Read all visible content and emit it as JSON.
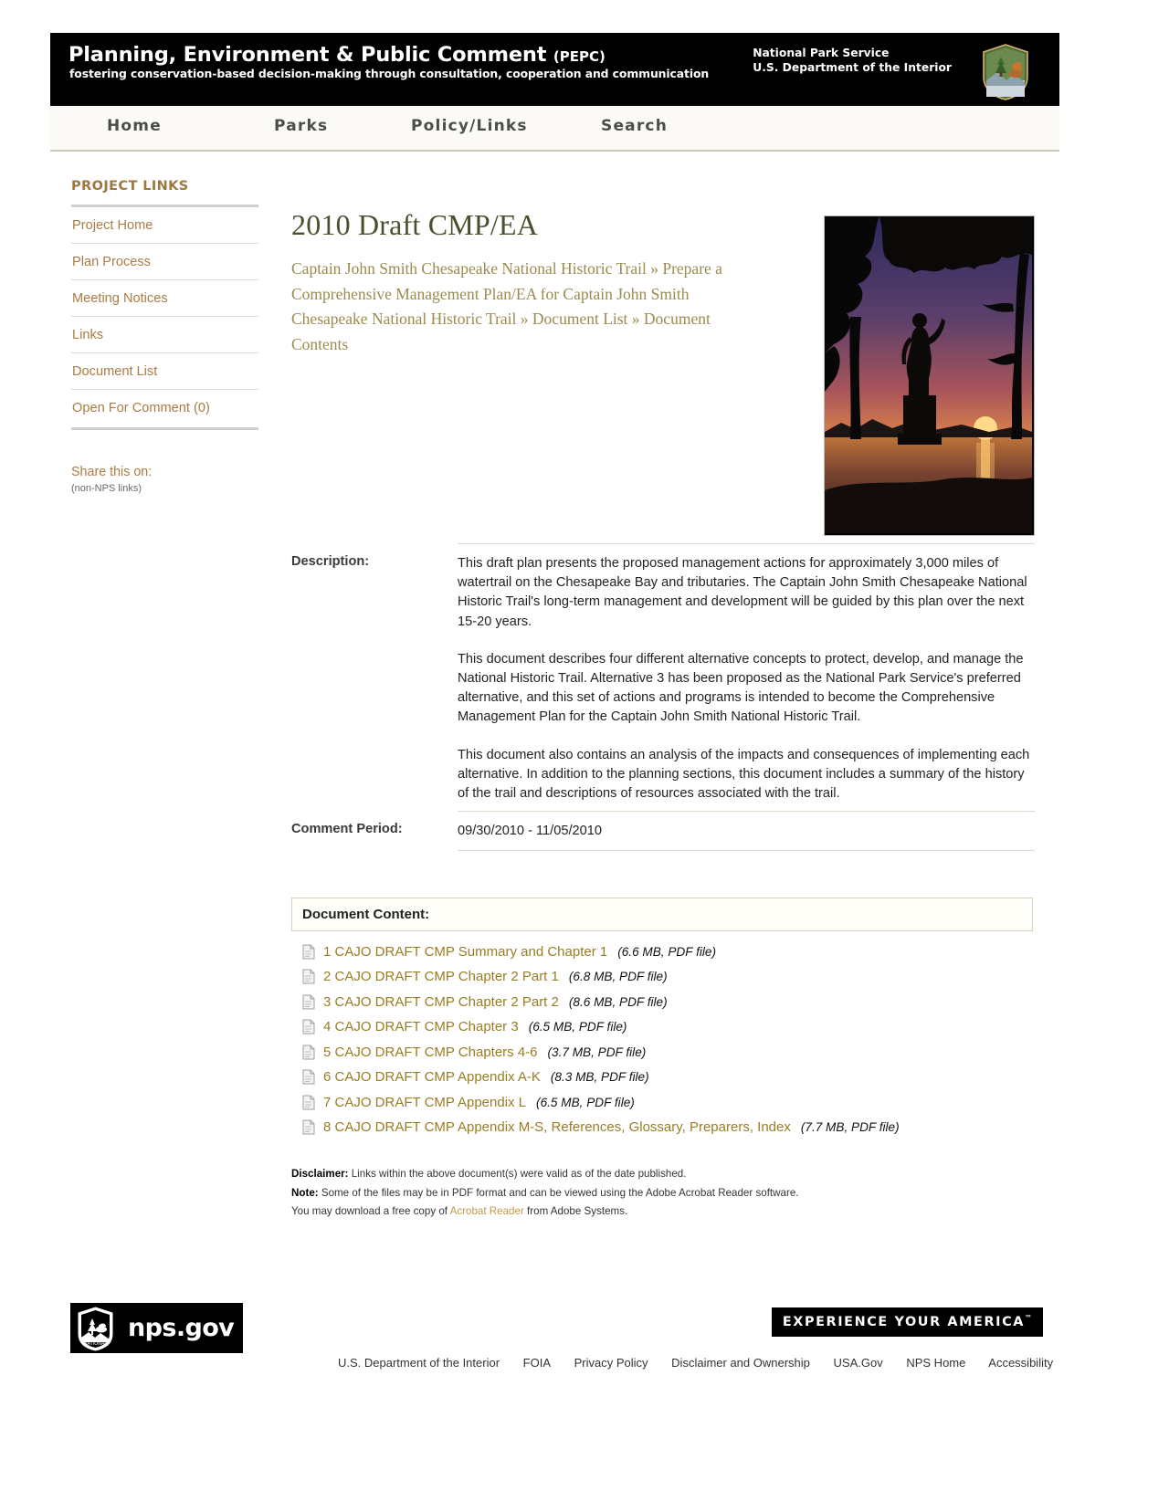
{
  "banner": {
    "title": "Planning, Environment & Public Comment",
    "acronym": "(PEPC)",
    "tagline": "fostering conservation-based decision-making through consultation, cooperation and communication",
    "agency_line1": "National Park Service",
    "agency_line2": "U.S. Department of the Interior",
    "logo_icon": "nps-arrowhead-icon"
  },
  "nav": {
    "items": [
      {
        "label": "Home"
      },
      {
        "label": "Parks"
      },
      {
        "label": "Policy/Links"
      },
      {
        "label": "Search"
      }
    ]
  },
  "sidebar": {
    "title": "PROJECT LINKS",
    "items": [
      {
        "label": "Project Home"
      },
      {
        "label": "Plan Process"
      },
      {
        "label": "Meeting Notices"
      },
      {
        "label": "Links"
      },
      {
        "label": "Document List"
      },
      {
        "label": "Open For Comment (0)"
      }
    ],
    "share_title": "Share this on:",
    "share_note": "(non-NPS links)"
  },
  "main": {
    "page_title": "2010 Draft CMP/EA",
    "breadcrumb": {
      "part1": "Captain John Smith Chesapeake National Historic Trail",
      "sep": "»",
      "part2": "Prepare a Comprehensive Management Plan/EA for Captain John Smith Chesapeake National Historic Trail",
      "part3": "Document List",
      "part4": "Document Contents"
    },
    "hero_image_alt": "captain-john-smith-statue-sunset-photo"
  },
  "meta": {
    "description_label": "Description:",
    "description_paragraphs": [
      "This draft plan presents the proposed management actions for approximately 3,000 miles of watertrail on the Chesapeake Bay and tributaries. The Captain John Smith Chesapeake National Historic Trail's long-term management and development will be guided by this plan over the next 15-20 years.",
      "This document describes four different alternative concepts to protect, develop, and manage the National Historic Trail. Alternative 3 has been proposed as the National Park Service's preferred alternative, and this set of actions and programs is intended to become the Comprehensive Management Plan for the Captain John Smith National Historic Trail.",
      "This document also contains an analysis of the impacts and consequences of implementing each alternative. In addition to the planning sections, this document includes a summary of the history of the trail and descriptions of resources associated with the trail."
    ],
    "comment_period_label": "Comment Period:",
    "comment_period_value": "09/30/2010 - 11/05/2010"
  },
  "document_content": {
    "header": "Document Content:",
    "items": [
      {
        "icon": "pdf-document-icon",
        "label": "1 CAJO DRAFT CMP Summary and Chapter 1",
        "size": "(6.6 MB, PDF file)"
      },
      {
        "icon": "pdf-document-icon",
        "label": "2 CAJO DRAFT CMP Chapter 2 Part 1",
        "size": "(6.8 MB, PDF file)"
      },
      {
        "icon": "pdf-document-icon",
        "label": "3 CAJO DRAFT CMP Chapter 2 Part 2",
        "size": "(8.6 MB, PDF file)"
      },
      {
        "icon": "pdf-document-icon",
        "label": "4 CAJO DRAFT CMP Chapter 3",
        "size": "(6.5 MB, PDF file)"
      },
      {
        "icon": "pdf-document-icon",
        "label": "5 CAJO DRAFT CMP Chapters 4-6",
        "size": "(3.7 MB, PDF file)"
      },
      {
        "icon": "pdf-document-icon",
        "label": "6 CAJO DRAFT CMP Appendix A-K",
        "size": "(8.3 MB, PDF file)"
      },
      {
        "icon": "pdf-document-icon",
        "label": "7 CAJO DRAFT CMP Appendix L",
        "size": "(6.5 MB, PDF file)"
      },
      {
        "icon": "pdf-document-icon",
        "label": "8 CAJO DRAFT CMP Appendix M-S, References, Glossary, Preparers, Index",
        "size": "(7.7 MB, PDF file)"
      }
    ]
  },
  "disclaimer": {
    "disclaimer_label": "Disclaimer:",
    "disclaimer_text": " Links within the above document(s) were valid as of the date published.",
    "note_label": "Note:",
    "note_text": " Some of the files may be in PDF format and can be viewed using the Adobe Acrobat Reader software.",
    "download_prefix": "You may download a free copy of ",
    "download_link": "Acrobat Reader",
    "download_suffix": " from Adobe Systems."
  },
  "footer": {
    "nps_gov_label": "nps.gov",
    "nps_gov_icon": "nps-arrowhead-icon",
    "experience": "EXPERIENCE YOUR AMERICA",
    "experience_tm": "™",
    "links": [
      {
        "label": "U.S. Department of the Interior"
      },
      {
        "label": "FOIA"
      },
      {
        "label": "Privacy Policy"
      },
      {
        "label": "Disclaimer and Ownership"
      },
      {
        "label": "USA.Gov"
      },
      {
        "label": "NPS Home"
      },
      {
        "label": "Accessibility"
      }
    ]
  },
  "colors": {
    "banner_bg": "#000000",
    "sidebar_link": "#a97c43",
    "sidebar_title": "#a0763f",
    "page_title": "#4a502e",
    "breadcrumb": "#9b8b4e",
    "doc_link": "#9a7d22"
  }
}
